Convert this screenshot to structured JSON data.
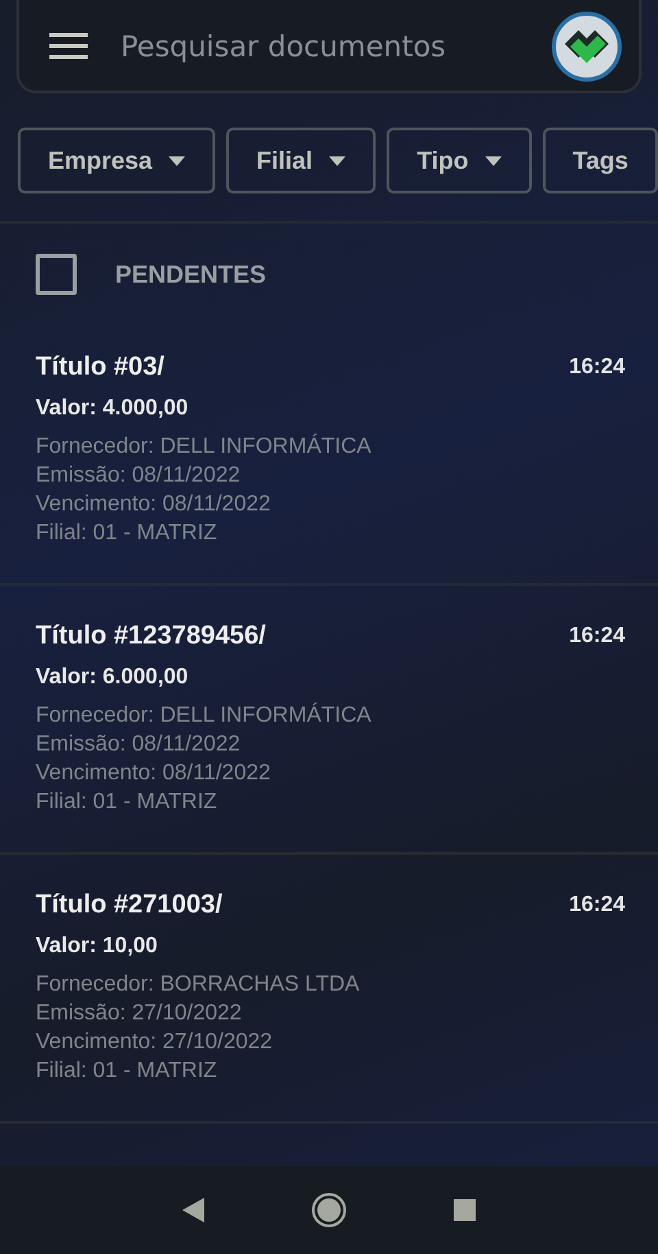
{
  "search": {
    "placeholder": "Pesquisar documentos"
  },
  "filters": [
    {
      "label": "Empresa",
      "dropdown": true
    },
    {
      "label": "Filial",
      "dropdown": true
    },
    {
      "label": "Tipo",
      "dropdown": true
    },
    {
      "label": "Tags",
      "dropdown": false
    }
  ],
  "section": {
    "title": "PENDENTES",
    "checked": false
  },
  "documents": [
    {
      "title": "Título #03/",
      "time": "16:24",
      "value": "Valor: 4.000,00",
      "details": [
        "Fornecedor: DELL INFORMÁTICA",
        "Emissão: 08/11/2022",
        "Vencimento: 08/11/2022",
        "Filial: 01 - MATRIZ"
      ]
    },
    {
      "title": "Título #123789456/",
      "time": "16:24",
      "value": "Valor: 6.000,00",
      "details": [
        "Fornecedor: DELL INFORMÁTICA",
        "Emissão: 08/11/2022",
        "Vencimento: 08/11/2022",
        "Filial: 01 - MATRIZ"
      ]
    },
    {
      "title": "Título #271003/",
      "time": "16:24",
      "value": "Valor: 10,00",
      "details": [
        "Fornecedor: BORRACHAS LTDA",
        "Emissão: 27/10/2022",
        "Vencimento: 27/10/2022",
        "Filial: 01 - MATRIZ"
      ]
    }
  ]
}
